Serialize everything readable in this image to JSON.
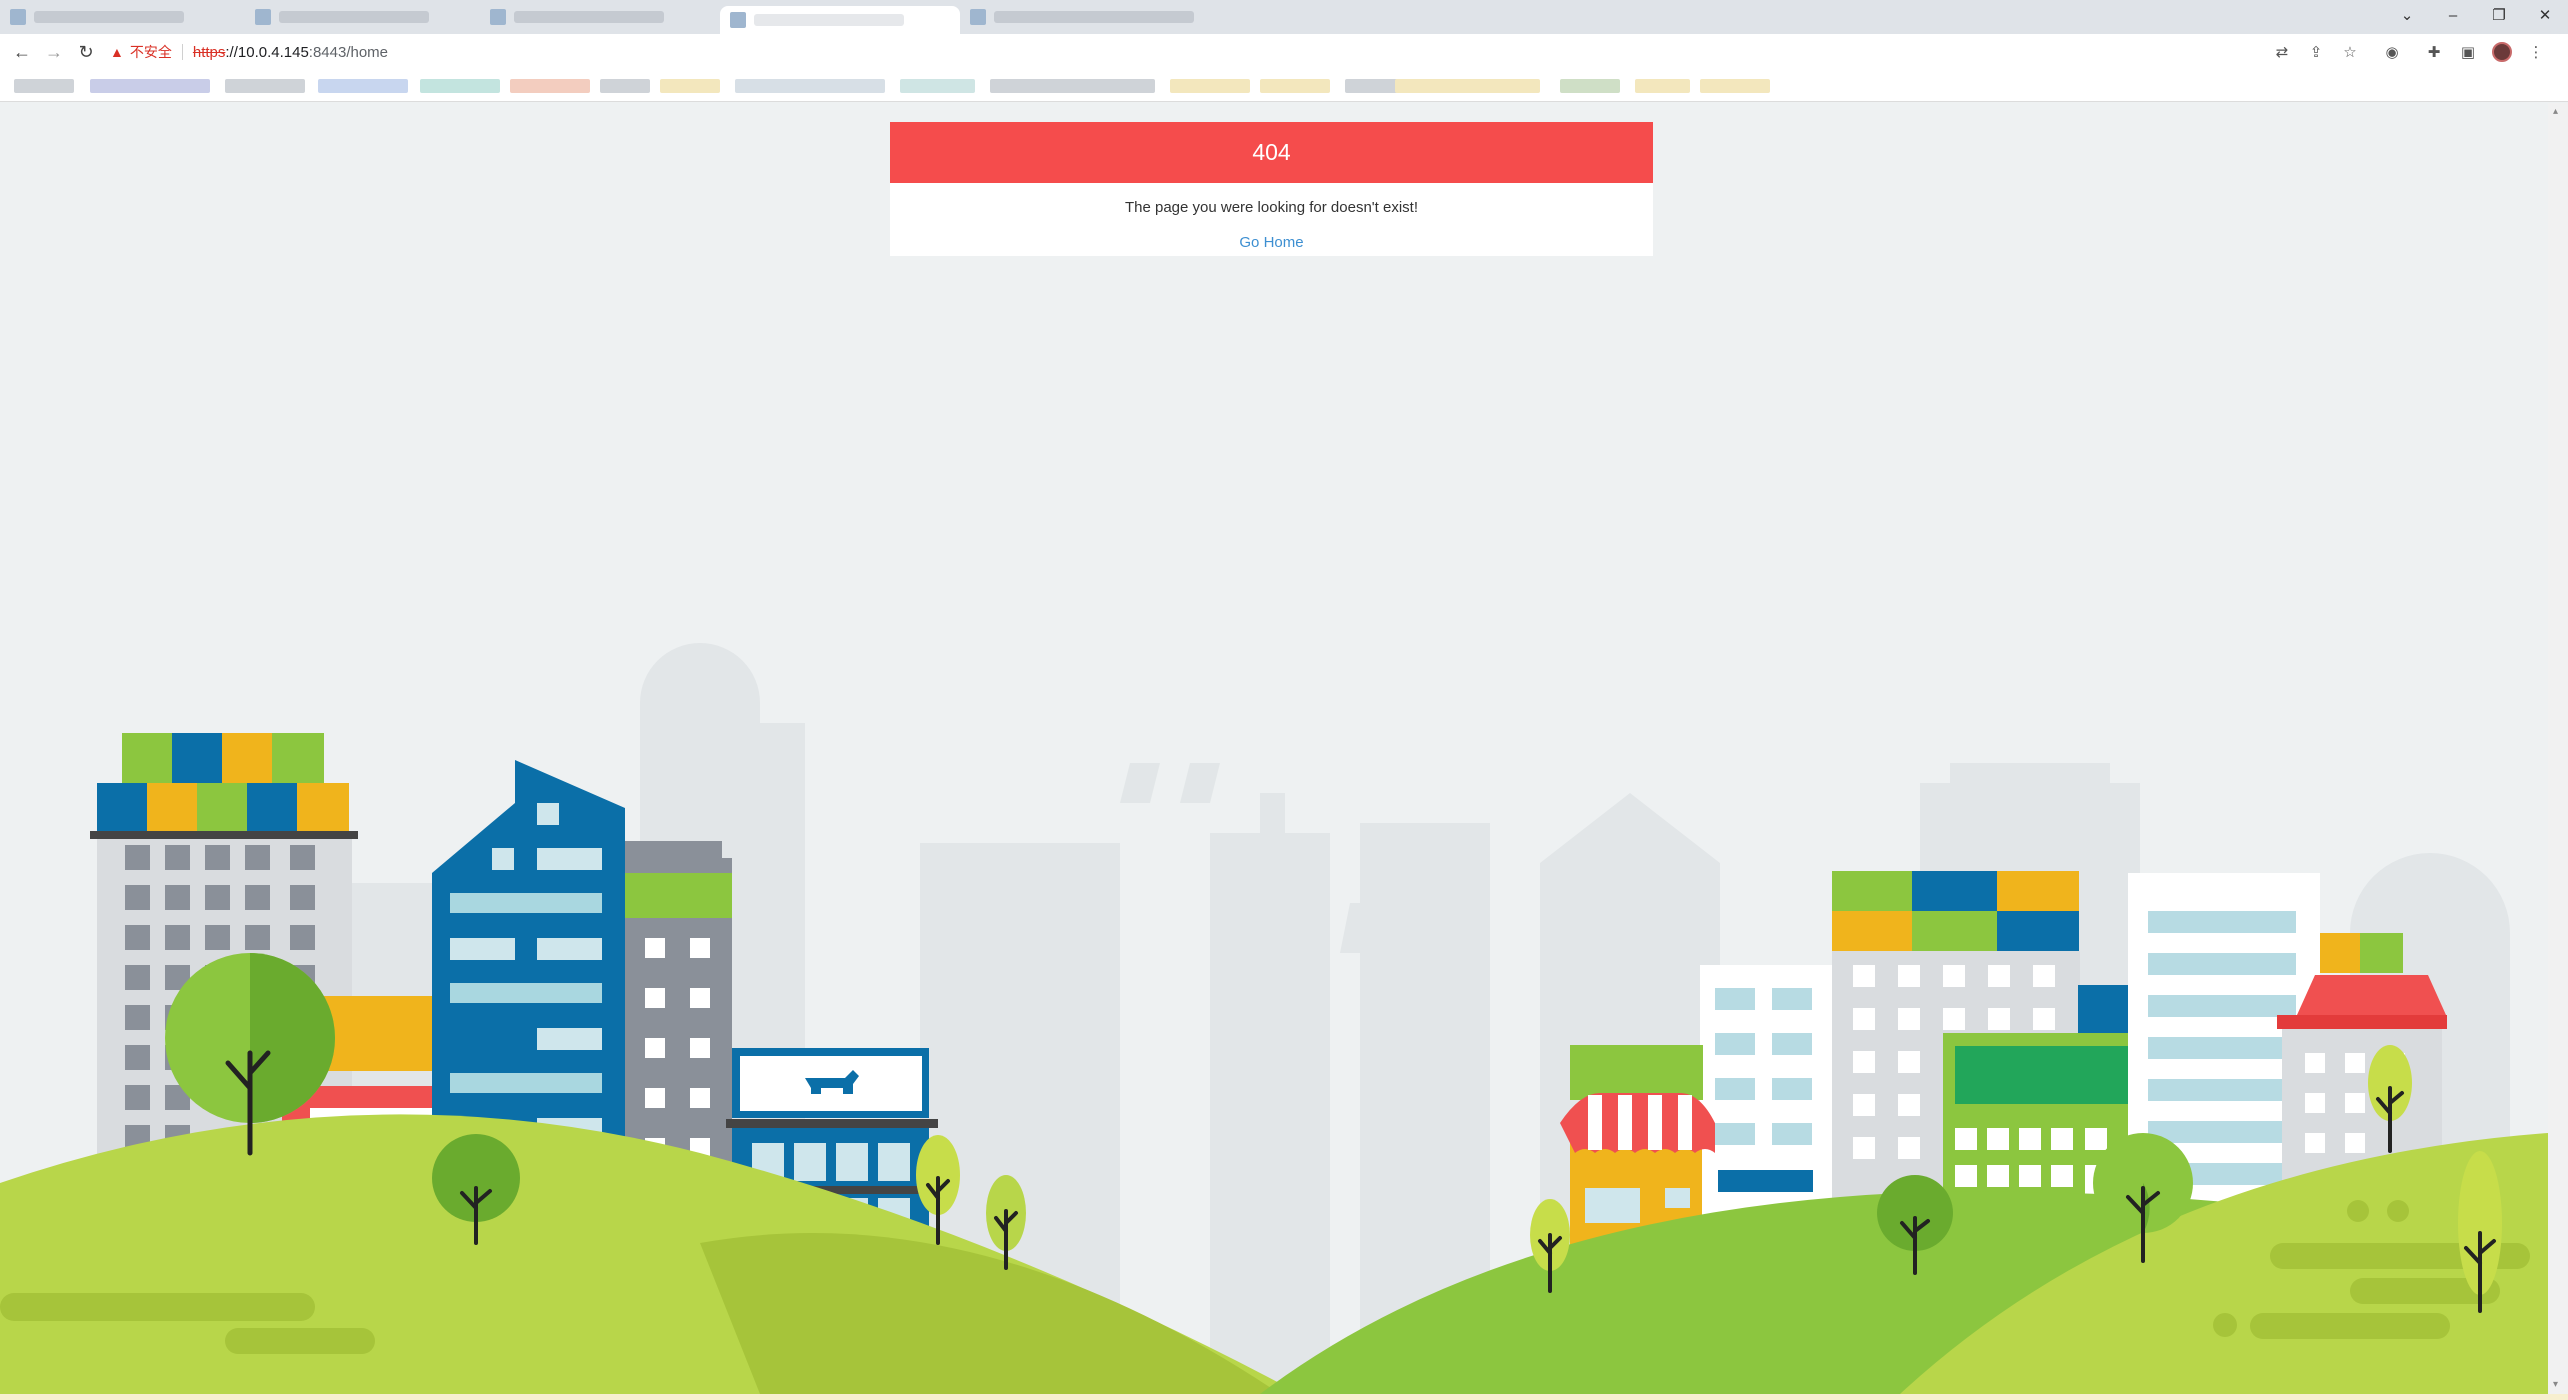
{
  "browser": {
    "window_controls": {
      "dropdown": "⌄",
      "minimize": "–",
      "restore": "❐",
      "close": "✕"
    },
    "nav": {
      "back": "←",
      "forward": "→",
      "reload": "↻"
    },
    "address": {
      "security_label": "不安全",
      "scheme": "https",
      "host": "://10.0.4.145",
      "rest": ":8443/home"
    },
    "icons": [
      "translate-icon",
      "share-icon",
      "star-icon",
      "extension-badge-icon",
      "puzzle-icon",
      "sidepanel-icon",
      "profile-avatar",
      "menu-icon"
    ]
  },
  "error": {
    "code": "404",
    "message": "The page you were looking for doesn't exist!",
    "link": "Go Home"
  },
  "colors": {
    "error_header": "#f54c4c",
    "link": "#3d8fd1",
    "page_bg": "#eef1f2",
    "hill_light": "#b8d64a",
    "hill_dark": "#8cc63f",
    "building_blue": "#0b6fa8",
    "container_yellow": "#f0b41c",
    "container_green": "#8cc63f",
    "awning_red": "#f05050"
  }
}
